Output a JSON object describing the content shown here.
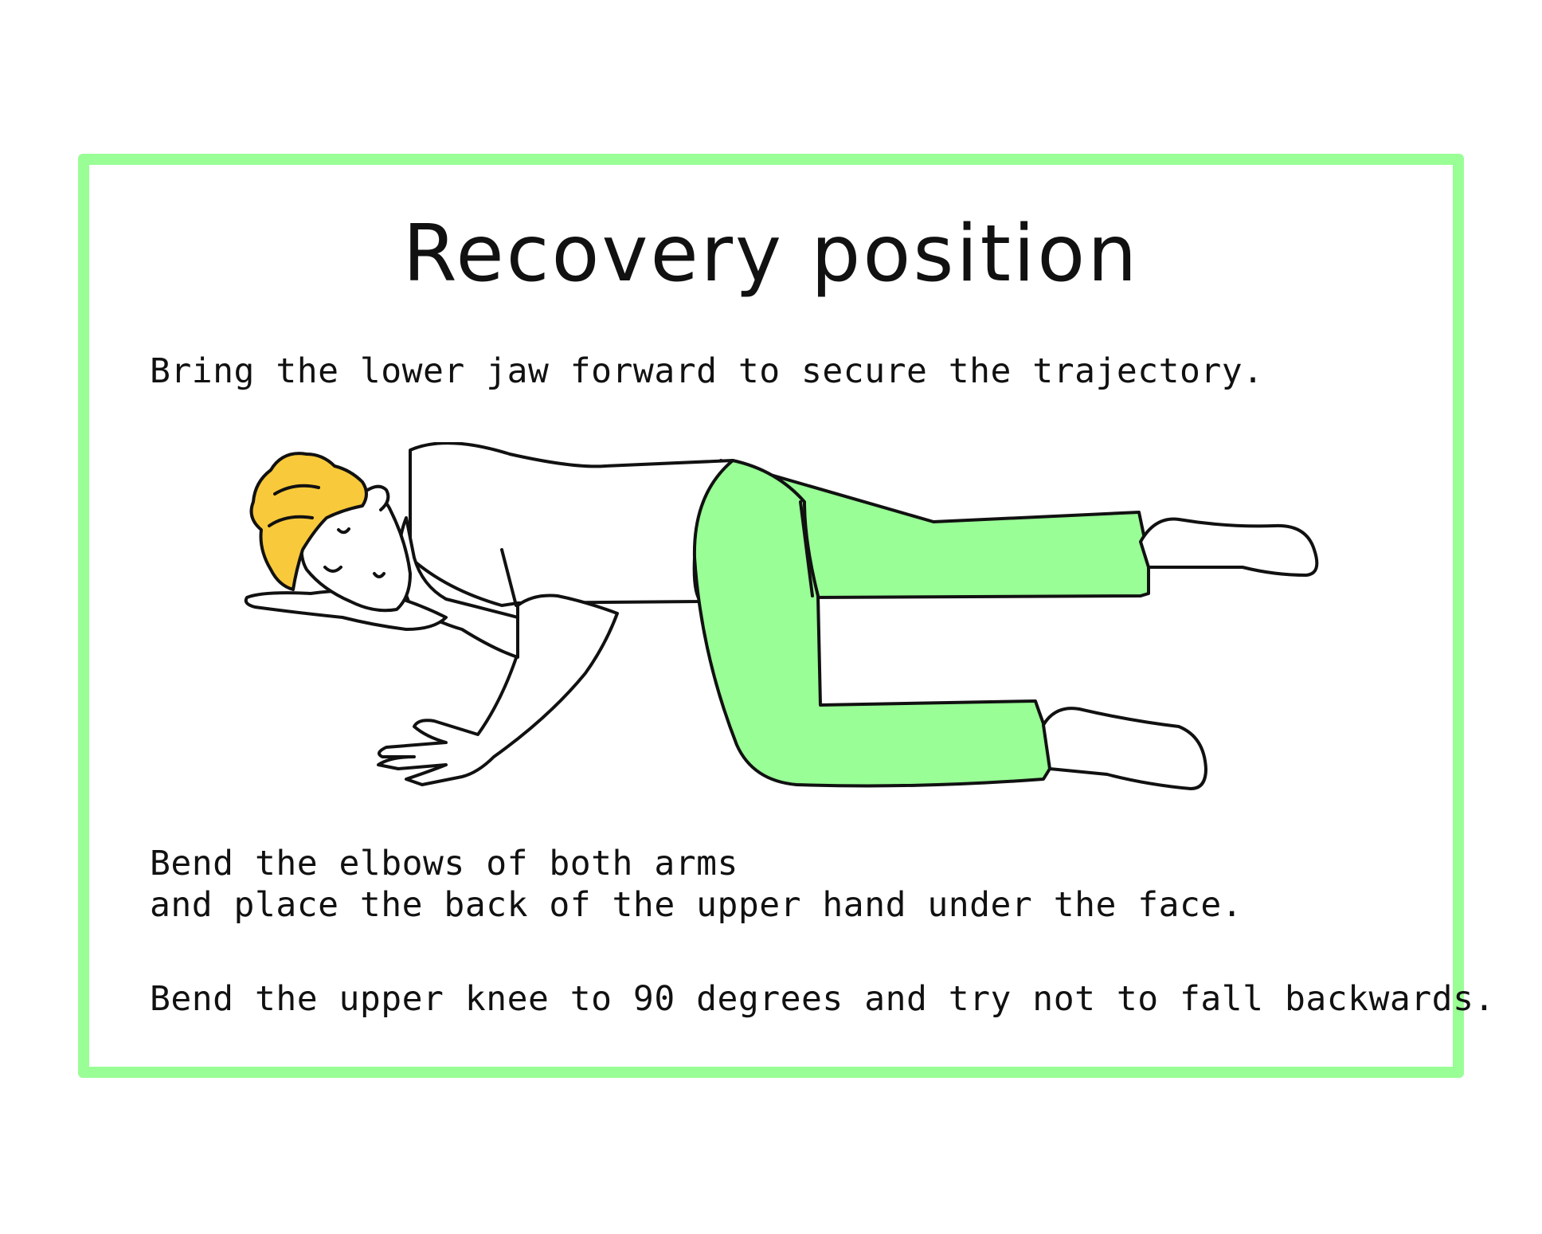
{
  "title": "Recovery position",
  "instructions": {
    "jaw": "Bring the lower jaw forward to secure the trajectory.",
    "arms_line1": "Bend the elbows of both arms",
    "arms_line2": "and place the back of the upper hand under the face.",
    "knee": "Bend the upper knee to 90 degrees and try not to fall backwards."
  },
  "colors": {
    "frame": "#99fe96",
    "pants": "#99fe96",
    "hair": "#f8c93a",
    "outline": "#111111"
  }
}
